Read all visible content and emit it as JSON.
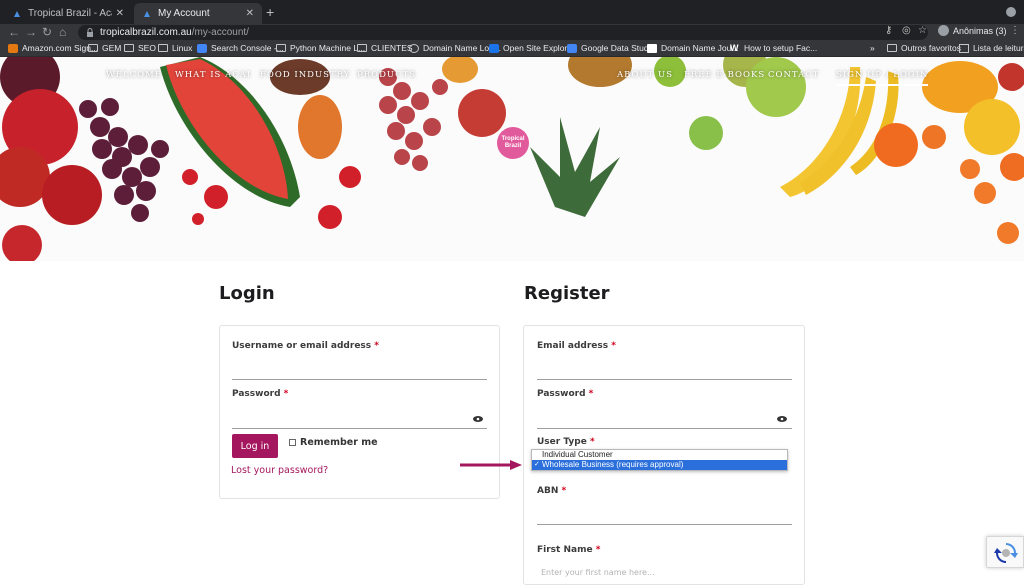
{
  "browser": {
    "tabs": [
      {
        "label": "Tropical Brazil - Acai Wholesal",
        "active": false
      },
      {
        "label": "My Account",
        "active": true
      }
    ],
    "url_host": "tropicalbrazil.com.au",
    "url_path": "/my-account/",
    "profile_label": "Anônimas (3)",
    "bookmarks": [
      "Amazon.com Sign...",
      "GEM",
      "SEO",
      "Linux",
      "Search Console -...",
      "Python Machine L...",
      "CLIENTES",
      "Domain Name Loo...",
      "Open Site Explorer",
      "Google Data Studio",
      "Domain Name Jou...",
      "How to setup Fac..."
    ],
    "other_bookmarks": "Outros favoritos",
    "reading_list": "Lista de leitura"
  },
  "site": {
    "logo_text": "Tropical Brazil",
    "nav": [
      "WELCOME",
      "WHAT IS ACAI",
      "FOOD INDUSTRY",
      "PRODUCTS",
      "ABOUT US",
      "FREE E-BOOKS",
      "CONTACT",
      "SIGN UP / LOGIN"
    ],
    "active_nav": "SIGN UP / LOGIN"
  },
  "login": {
    "title": "Login",
    "username_label": "Username or email address",
    "password_label": "Password",
    "required_mark": "*",
    "button": "Log in",
    "remember": "Remember me",
    "lost_password": "Lost your password?"
  },
  "register": {
    "title": "Register",
    "email_label": "Email address",
    "password_label": "Password",
    "user_type_label": "User Type",
    "user_type_options": [
      "Individual Customer",
      "Wholesale Business (requires approval)"
    ],
    "user_type_selected": "Wholesale Business (requires approval)",
    "check_mark": "✓",
    "abn_label": "ABN",
    "first_name_label": "First Name",
    "first_name_placeholder": "Enter your first name here..."
  },
  "colors": {
    "brand": "#a4175e",
    "chrome_dark": "#202124",
    "chrome_mid": "#35363a",
    "select_highlight": "#2a6fdb"
  }
}
